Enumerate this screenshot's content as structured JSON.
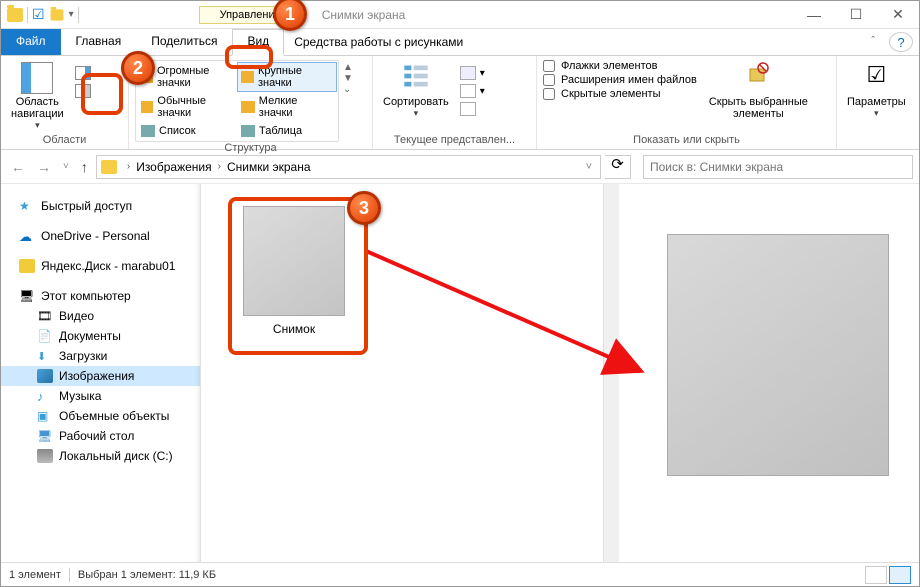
{
  "title_context_tab": "Управление",
  "title": "Снимки экрана",
  "menu": {
    "file": "Файл",
    "home": "Главная",
    "share": "Поделиться",
    "view": "Вид",
    "tool": "Средства работы с рисунками"
  },
  "ribbon": {
    "group1": {
      "nav_btn": "Область\nнавигации",
      "label": "Области"
    },
    "group2": {
      "opts": [
        "Огромные значки",
        "Крупные значки",
        "Обычные значки",
        "Мелкие значки",
        "Список",
        "Таблица"
      ],
      "label": "Структура"
    },
    "group3": {
      "sort": "Сортировать",
      "label": "Текущее представлен..."
    },
    "group4": {
      "chk1": "Флажки элементов",
      "chk2": "Расширения имен файлов",
      "chk3": "Скрытые элементы",
      "hide": "Скрыть выбранные\nэлементы",
      "label": "Показать или скрыть"
    },
    "group5": {
      "params": "Параметры"
    }
  },
  "breadcrumb": {
    "p1": "Изображения",
    "p2": "Снимки экрана"
  },
  "search_placeholder": "Поиск в: Снимки экрана",
  "nav": {
    "quick": "Быстрый доступ",
    "onedrive": "OneDrive - Personal",
    "yadisk": "Яндекс.Диск - marabu01",
    "thispc": "Этот компьютер",
    "videos": "Видео",
    "docs": "Документы",
    "downloads": "Загрузки",
    "pictures": "Изображения",
    "music": "Музыка",
    "objects3d": "Объемные объекты",
    "desktop": "Рабочий стол",
    "cdrive": "Локальный диск (C:)"
  },
  "file_caption": "Снимок",
  "status": {
    "count": "1 элемент",
    "sel": "Выбран 1 элемент: 11,9 КБ"
  },
  "badges": {
    "b1": "1",
    "b2": "2",
    "b3": "3"
  }
}
